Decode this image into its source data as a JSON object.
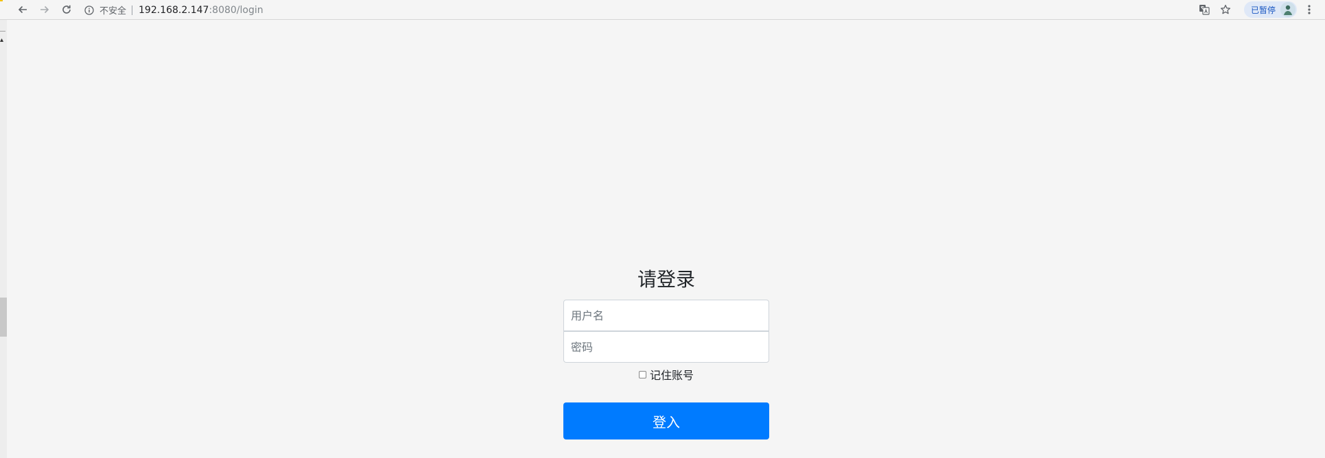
{
  "browser": {
    "security_label": "不安全",
    "url_host": "192.168.2.147",
    "url_path": ":8080/login",
    "profile_label": "已暂停",
    "icons": {
      "back": "arrow-left-icon",
      "forward": "arrow-right-icon",
      "reload": "reload-icon",
      "security": "info-icon",
      "translate": "translate-icon",
      "bookmark": "star-icon",
      "menu": "kebab-menu-icon"
    }
  },
  "login": {
    "title": "请登录",
    "username_placeholder": "用户名",
    "password_placeholder": "密码",
    "remember_label": "记住账号",
    "remember_checked": false,
    "submit_label": "登入"
  },
  "colors": {
    "page_background": "#f5f5f5",
    "primary_button": "#007bff",
    "input_border": "#ced4da",
    "profile_chip": "#dfe8f7"
  }
}
